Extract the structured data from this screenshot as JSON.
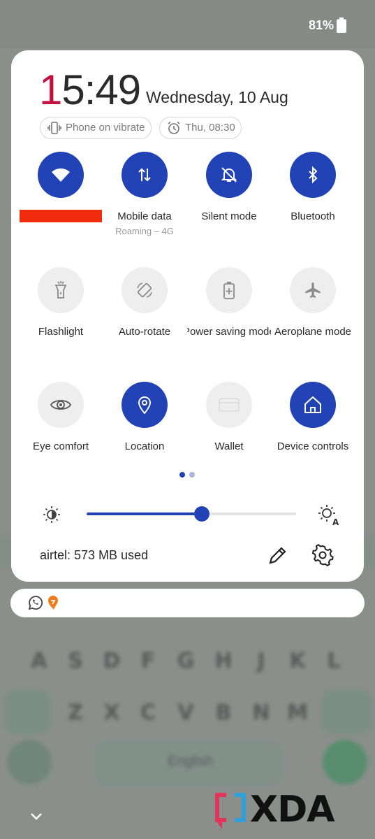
{
  "status_bar": {
    "battery_percent": "81%",
    "battery_icon": "battery-icon"
  },
  "header": {
    "clock_first_digit": "1",
    "clock_rest": "5:49",
    "date": "Wednesday, 10 Aug",
    "chips": [
      {
        "label": "Phone on vibrate",
        "icon": "vibrate-icon"
      },
      {
        "label": "Thu, 08:30",
        "icon": "alarm-icon"
      }
    ]
  },
  "tiles": [
    {
      "label": "",
      "sublabel": "",
      "icon": "wifi-icon",
      "active": true
    },
    {
      "label": "Mobile data",
      "sublabel": "Roaming – 4G",
      "icon": "mobile-data-icon",
      "active": true
    },
    {
      "label": "Silent mode",
      "sublabel": "",
      "icon": "bell-off-icon",
      "active": true
    },
    {
      "label": "Bluetooth",
      "sublabel": "",
      "icon": "bluetooth-icon",
      "active": true
    },
    {
      "label": "Flashlight",
      "sublabel": "",
      "icon": "flashlight-icon",
      "active": false
    },
    {
      "label": "Auto-rotate",
      "sublabel": "",
      "icon": "auto-rotate-icon",
      "active": false
    },
    {
      "label": "Power saving mode",
      "sublabel": "",
      "icon": "battery-saver-icon",
      "active": false
    },
    {
      "label": "Aeroplane mode",
      "sublabel": "",
      "icon": "airplane-icon",
      "active": false
    },
    {
      "label": "Eye comfort",
      "sublabel": "",
      "icon": "eye-icon",
      "active": false
    },
    {
      "label": "Location",
      "sublabel": "",
      "icon": "location-icon",
      "active": true
    },
    {
      "label": "Wallet",
      "sublabel": "",
      "icon": "wallet-icon",
      "active": false
    },
    {
      "label": "Device controls",
      "sublabel": "",
      "icon": "home-icon",
      "active": true
    }
  ],
  "pager": {
    "pages": 2,
    "current": 1
  },
  "brightness": {
    "level": 0.55,
    "low_icon": "brightness-low-icon",
    "auto_icon": "brightness-auto-icon"
  },
  "footer": {
    "data_usage": "airtel: 573 MB used",
    "edit_icon": "pencil-icon",
    "settings_icon": "gear-icon"
  },
  "notification": {
    "icons": [
      "whatsapp-icon",
      "swiggy-icon"
    ]
  },
  "keyboard": {
    "row1": [
      "A",
      "S",
      "D",
      "F",
      "G",
      "H",
      "J",
      "K",
      "L"
    ],
    "row2": [
      "Z",
      "X",
      "C",
      "V",
      "B",
      "N",
      "M"
    ],
    "space_label": "English"
  },
  "watermark": {
    "text": "XDA"
  },
  "colors": {
    "accent": "#2143b5",
    "clock_red": "#c3123f",
    "inactive_tile": "#eeeeee"
  }
}
